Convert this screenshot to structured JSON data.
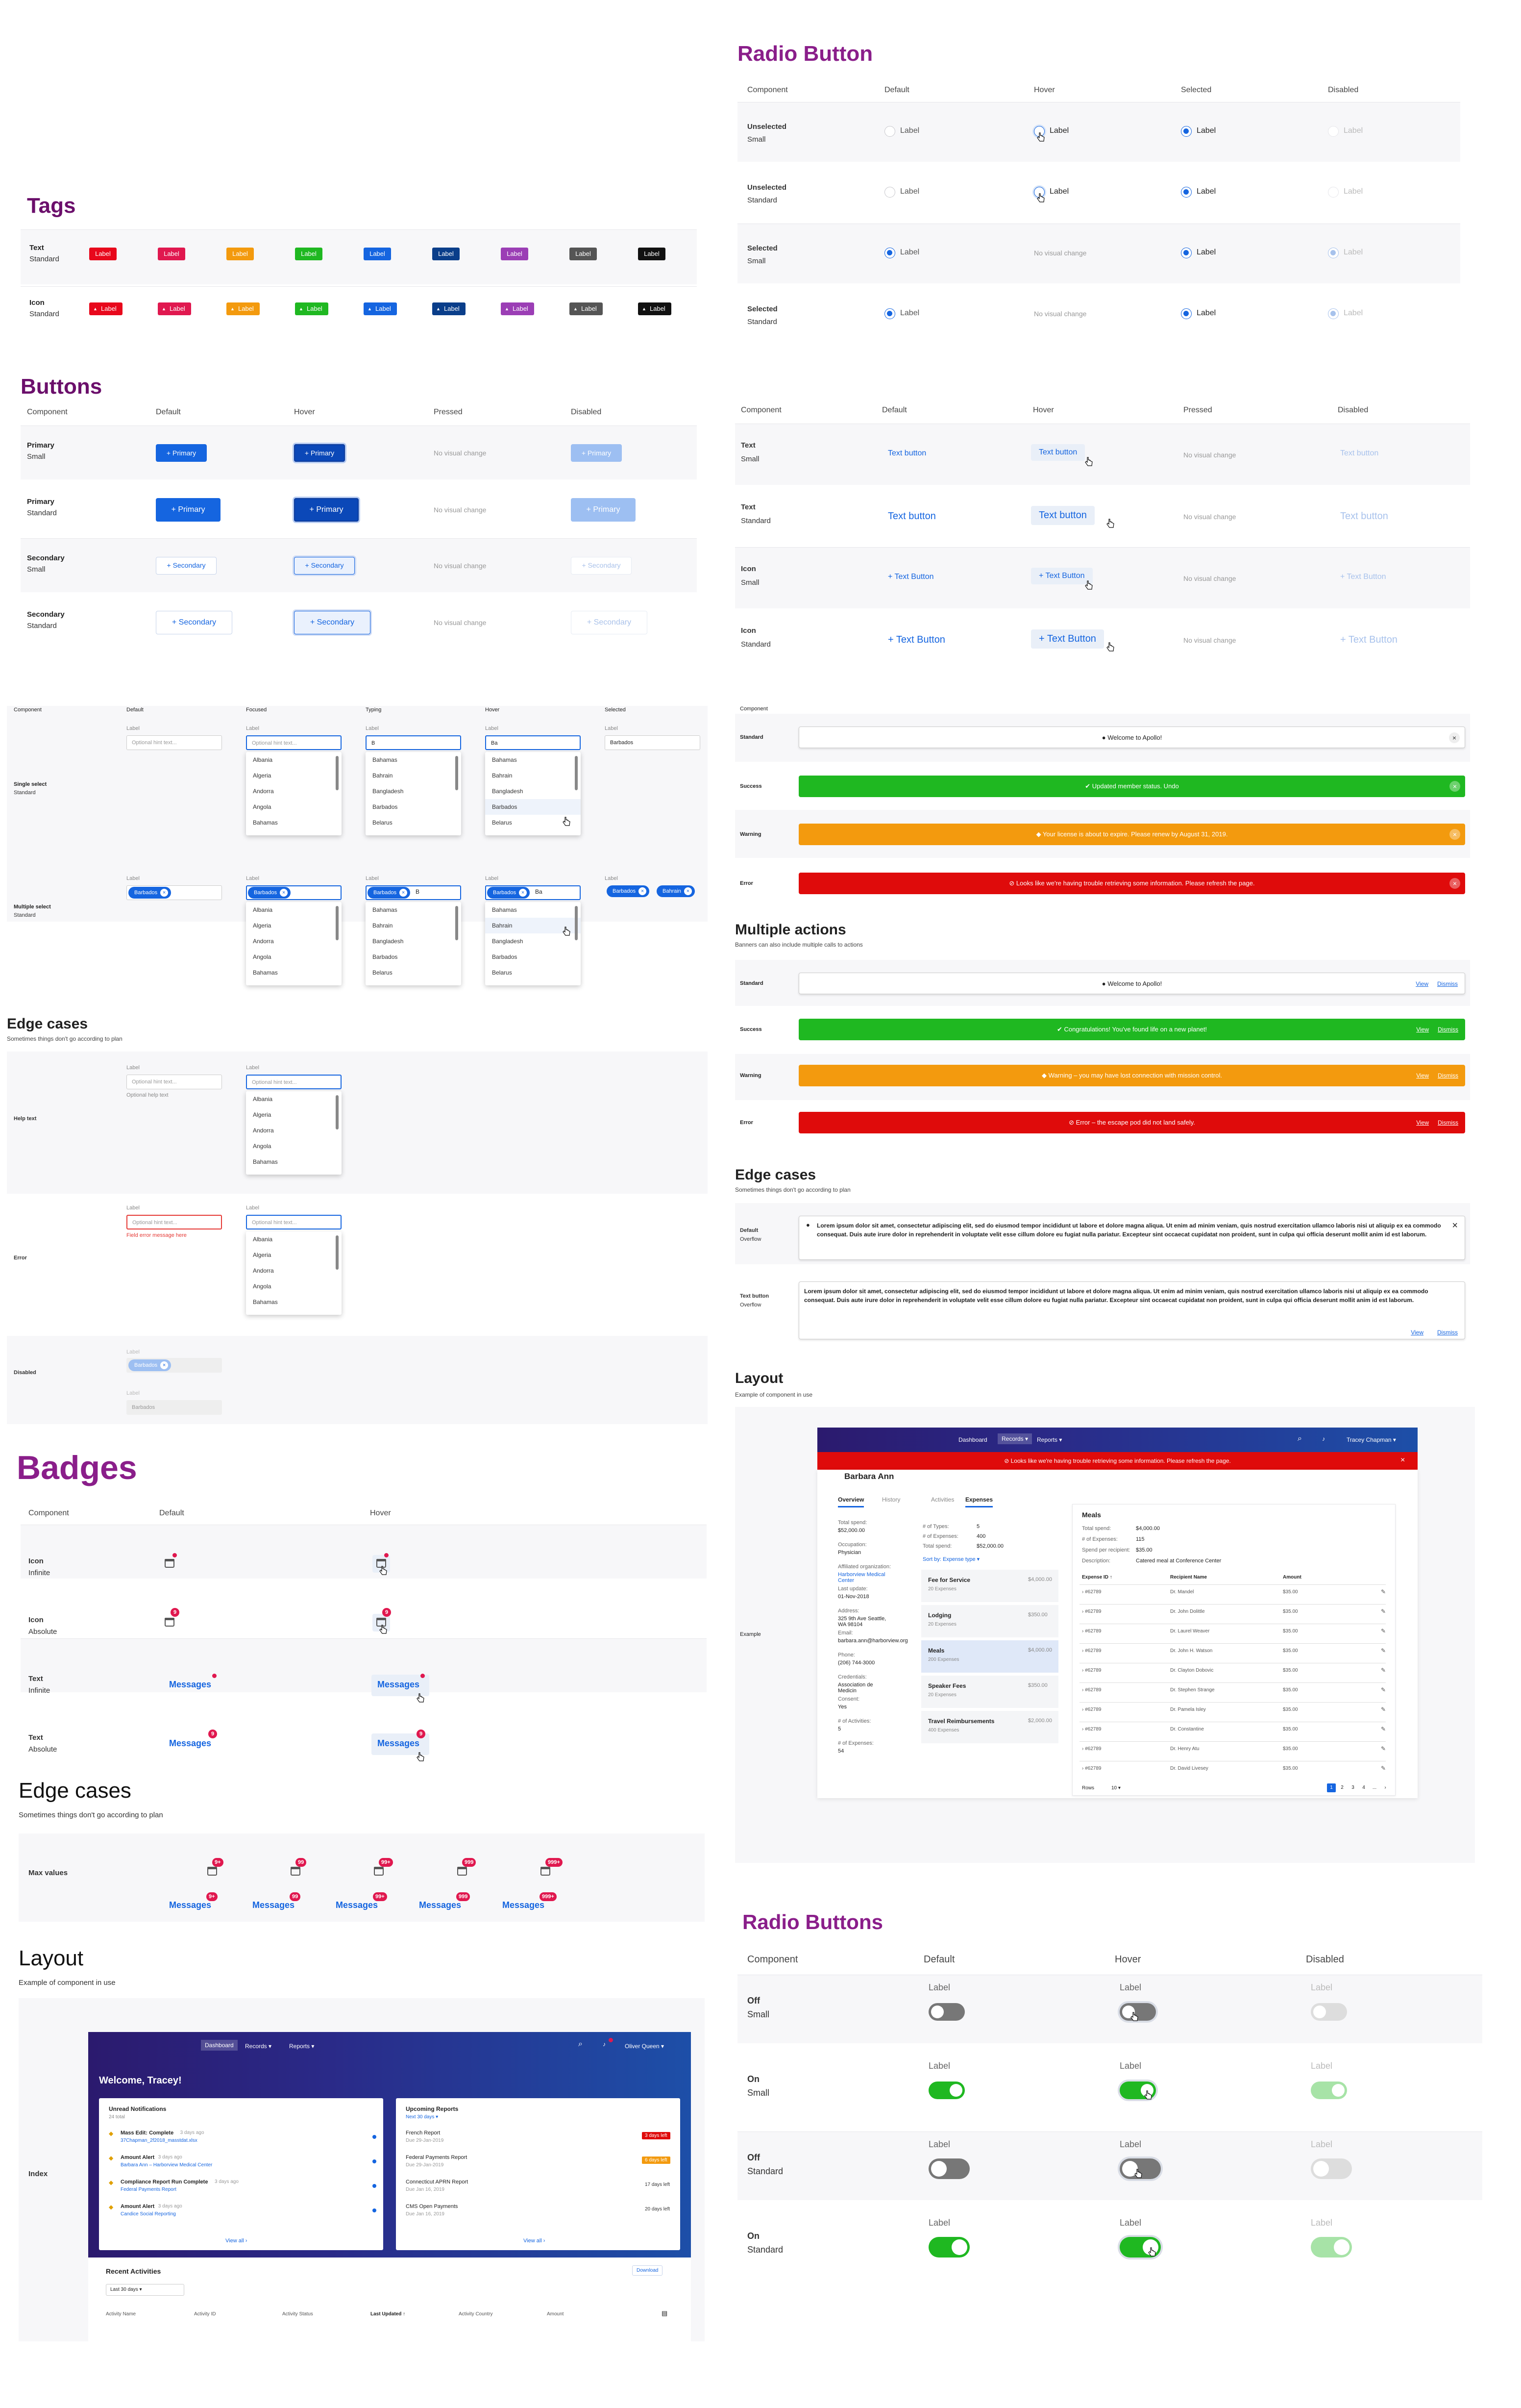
{
  "tags": {
    "title": "Tags",
    "rows": [
      {
        "label": "Text",
        "sub": "Standard"
      },
      {
        "label": "Icon",
        "sub": "Standard"
      }
    ],
    "tag_label": "Label",
    "colors": [
      "#e8081c",
      "#e0184f",
      "#f39a0e",
      "#1fb821",
      "#1565e0",
      "#0a3e8a",
      "#9b3eb5",
      "#555555",
      "#111111"
    ]
  },
  "buttons": {
    "title": "Buttons",
    "cols": [
      "Component",
      "Default",
      "Hover",
      "Pressed",
      "Disabled"
    ],
    "rows": [
      {
        "label": "Primary",
        "sub": "Small"
      },
      {
        "label": "Primary",
        "sub": "Standard"
      },
      {
        "label": "Secondary",
        "sub": "Small"
      },
      {
        "label": "Secondary",
        "sub": "Standard"
      }
    ],
    "primary": "Primary",
    "secondary": "Secondary",
    "no_change": "No visual change"
  },
  "text_buttons": {
    "cols": [
      "Component",
      "Default",
      "Hover",
      "Pressed",
      "Disabled"
    ],
    "rows": [
      {
        "label": "Text",
        "sub": "Small"
      },
      {
        "label": "Text",
        "sub": "Standard"
      },
      {
        "label": "Icon",
        "sub": "Small"
      },
      {
        "label": "Icon",
        "sub": "Standard"
      }
    ],
    "text": "Text button",
    "icon": "Text Button",
    "no_change": "No visual change"
  },
  "radio": {
    "title": "Radio Button",
    "cols": [
      "Component",
      "Default",
      "Hover",
      "Selected",
      "Disabled"
    ],
    "rows": [
      {
        "label": "Unselected",
        "sub": "Small"
      },
      {
        "label": "Unselected",
        "sub": "Standard"
      },
      {
        "label": "Selected",
        "sub": "Small"
      },
      {
        "label": "Selected",
        "sub": "Standard"
      }
    ],
    "label": "Label",
    "no_change": "No visual change"
  },
  "select": {
    "cols": [
      "Component",
      "Default",
      "Focused",
      "Typing",
      "Hover",
      "Selected"
    ],
    "rows": [
      {
        "label": "Single select",
        "sub": "Standard"
      },
      {
        "label": "Multiple select",
        "sub": "Standard"
      }
    ],
    "label": "Label",
    "placeholder": "Optional hint text...",
    "typed": "B",
    "typed2": "Ba",
    "selected": "Barbados",
    "countries": [
      "Albania",
      "Algeria",
      "Andorra",
      "Angola",
      "Bahamas"
    ],
    "b_countries": [
      "Bahamas",
      "Bahrain",
      "Bangladesh",
      "Barbados",
      "Belarus"
    ],
    "chip1": "Barbados",
    "chip2": "Bahrain"
  },
  "select_edge": {
    "title": "Edge cases",
    "subtitle": "Sometimes things don't go according to plan",
    "rows": [
      "Help text",
      "Error",
      "Disabled"
    ],
    "help": "Optional help text",
    "error": "Field error message here",
    "label": "Label",
    "placeholder": "Optional hint text...",
    "disabled_value": "Barbados"
  },
  "banners": {
    "component": "Component",
    "rows": [
      "Standard",
      "Success",
      "Warning",
      "Error"
    ],
    "messages": [
      "Welcome to Apollo!",
      "Updated member status. Undo",
      "Your license is about to expire. Please renew by August 31, 2019.",
      "Looks like we're having trouble retrieving some information. Please refresh the page."
    ],
    "multi_title": "Multiple actions",
    "multi_subtitle": "Banners can also include multiple calls to actions",
    "multi_messages": [
      "Welcome to Apollo!",
      "Congratulations! You've found life on a new planet!",
      "Warning – you may have lost connection with mission control.",
      "Error – the escape pod did not land safely."
    ],
    "view": "View",
    "dismiss": "Dismiss"
  },
  "banner_edge": {
    "title": "Edge cases",
    "subtitle": "Sometimes things don't go according to plan",
    "rows": [
      {
        "label": "Default",
        "sub": "Overflow"
      },
      {
        "label": "Text button",
        "sub": "Overflow"
      }
    ],
    "lorem": "Lorem ipsum dolor sit amet, consectetur adipiscing elit, sed do eiusmod tempor incididunt ut labore et dolore magna aliqua. Ut enim ad minim veniam, quis nostrud exercitation ullamco laboris nisi ut aliquip ex ea commodo consequat. Duis aute irure dolor in reprehenderit in voluptate velit esse cillum dolore eu fugiat nulla pariatur. Excepteur sint occaecat cupidatat non proident, sunt in culpa qui officia deserunt mollit anim id est laborum.",
    "view": "View",
    "dismiss": "Dismiss"
  },
  "banner_layout": {
    "title": "Layout",
    "subtitle": "Example of component in use",
    "row": "Example",
    "nav": [
      "Dashboard",
      "Records ▾",
      "Reports ▾"
    ],
    "user": "Tracey Chapman ▾",
    "error": "Looks like we're having trouble retrieving some information. Please refresh the page.",
    "person": "Barbara Ann",
    "tabs": [
      "Overview",
      "History",
      "Activities",
      "Expenses"
    ],
    "fields": [
      [
        "Total spend:",
        "$52,000.00"
      ],
      [
        "Occupation:",
        "Physician"
      ],
      [
        "Affiliated organization:",
        "Harborview Medical Center"
      ],
      [
        "Last update:",
        "01-Nov-2018"
      ],
      [
        "Address:",
        "325 9th Ave Seattle, WA 98104"
      ],
      [
        "Email:",
        "barbara.ann@harborview.org"
      ],
      [
        "Phone:",
        "(206) 744-3000"
      ],
      [
        "Credentials:",
        "Association de Medicin"
      ],
      [
        "Consent:",
        "Yes"
      ],
      [
        "# of Activities:",
        "5"
      ],
      [
        "# of Expenses:",
        "54"
      ]
    ],
    "summary": [
      [
        "# of Types:",
        "5"
      ],
      [
        "# of Expenses:",
        "400"
      ],
      [
        "Total spend:",
        "$52,000.00"
      ]
    ],
    "sort": "Sort by: Expense type ▾",
    "cats": [
      [
        "Fee for Service",
        "$4,000.00",
        "20 Expenses"
      ],
      [
        "Lodging",
        "$350.00",
        "20 Expenses"
      ],
      [
        "Meals",
        "$4,000.00",
        "200 Expenses"
      ],
      [
        "Speaker Fees",
        "$350.00",
        "20 Expenses"
      ],
      [
        "Travel Reimbursements",
        "$2,000.00",
        "400 Expenses"
      ]
    ],
    "meals": {
      "title": "Meals",
      "rows": [
        [
          "Total spend:",
          "$4,000.00"
        ],
        [
          "# of Expenses:",
          "115"
        ],
        [
          "Spend per recipient:",
          "$35.00"
        ],
        [
          "Description:",
          "Catered meal at Conference Center"
        ]
      ]
    },
    "cols": [
      "Expense ID ↑",
      "Recipient Name",
      "Amount"
    ],
    "table": [
      [
        "#62789",
        "Dr. Mandel",
        "$35.00"
      ],
      [
        "#62789",
        "Dr. John Dolittle",
        "$35.00"
      ],
      [
        "#62789",
        "Dr. Laurel Weaver",
        "$35.00"
      ],
      [
        "#62789",
        "Dr. John H. Watson",
        "$35.00"
      ],
      [
        "#62789",
        "Dr. Clayton Dobovic",
        "$35.00"
      ],
      [
        "#62789",
        "Dr. Stephen Strange",
        "$35.00"
      ],
      [
        "#62789",
        "Dr. Pamela Isley",
        "$35.00"
      ],
      [
        "#62789",
        "Dr. Constantine",
        "$35.00"
      ],
      [
        "#62789",
        "Dr. Henry Atu",
        "$35.00"
      ],
      [
        "#62789",
        "Dr. David Livesey",
        "$35.00"
      ]
    ],
    "rows_label": "Rows",
    "rows_value": "10 ▾",
    "pages": [
      "1",
      "2",
      "3",
      "4",
      "...",
      "›"
    ]
  },
  "badges": {
    "title": "Badges",
    "cols": [
      "Component",
      "Default",
      "Hover"
    ],
    "rows": [
      {
        "label": "Icon",
        "sub": "Infinite"
      },
      {
        "label": "Icon",
        "sub": "Absolute"
      },
      {
        "label": "Text",
        "sub": "Infinite"
      },
      {
        "label": "Text",
        "sub": "Absolute"
      }
    ],
    "count": "9",
    "messages": "Messages",
    "edge_title": "Edge cases",
    "edge_subtitle": "Sometimes things don't go according to plan",
    "max_label": "Max values",
    "max_values": [
      "9+",
      "99",
      "99+",
      "999",
      "999+"
    ]
  },
  "badge_layout": {
    "title": "Layout",
    "subtitle": "Example of component in use",
    "row": "Index",
    "nav": [
      "Dashboard",
      "Records ▾",
      "Reports ▾"
    ],
    "user": "Oliver Queen ▾",
    "welcome": "Welcome, Tracey!",
    "notif_title": "Unread Notifications",
    "notif_sub": "24 total",
    "notifs": [
      [
        "Mass Edit: Complete",
        "3 days ago",
        "37Chapman_2f2018_masstdat.xlsx"
      ],
      [
        "Amount Alert",
        "3 days ago",
        "Barbara Ann – Harborview Medical Center"
      ],
      [
        "Compliance Report Run Complete",
        "3 days ago",
        "Federal Payments Report"
      ],
      [
        "Amount Alert",
        "3 days ago",
        "Candice Social Reporting"
      ]
    ],
    "reports_title": "Upcoming Reports",
    "reports_sub": "Next 30 days ▾",
    "reports": [
      [
        "French Report",
        "Due 29-Jan-2019",
        "3 days left"
      ],
      [
        "Federal Payments Report",
        "Due 29-Jan-2019",
        "6 days left"
      ],
      [
        "Connecticut APRN Report",
        "Due Jan 16, 2019",
        "17 days left"
      ],
      [
        "CMS Open Payments",
        "Due Jan 16, 2019",
        "20 days left"
      ]
    ],
    "view_all": "View all ›",
    "recent": "Recent Activities",
    "download": "Download",
    "range": "Last 30 days ▾",
    "table_cols": [
      "Activity Name",
      "Activity ID",
      "Activity Status",
      "Last Updated ↑",
      "Activity Country",
      "Amount"
    ]
  },
  "toggles": {
    "title": "Radio Buttons",
    "cols": [
      "Component",
      "Default",
      "Hover",
      "Disabled"
    ],
    "rows": [
      {
        "label": "Off",
        "sub": "Small"
      },
      {
        "label": "On",
        "sub": "Small"
      },
      {
        "label": "Off",
        "sub": "Standard"
      },
      {
        "label": "On",
        "sub": "Standard"
      }
    ],
    "label": "Label"
  }
}
